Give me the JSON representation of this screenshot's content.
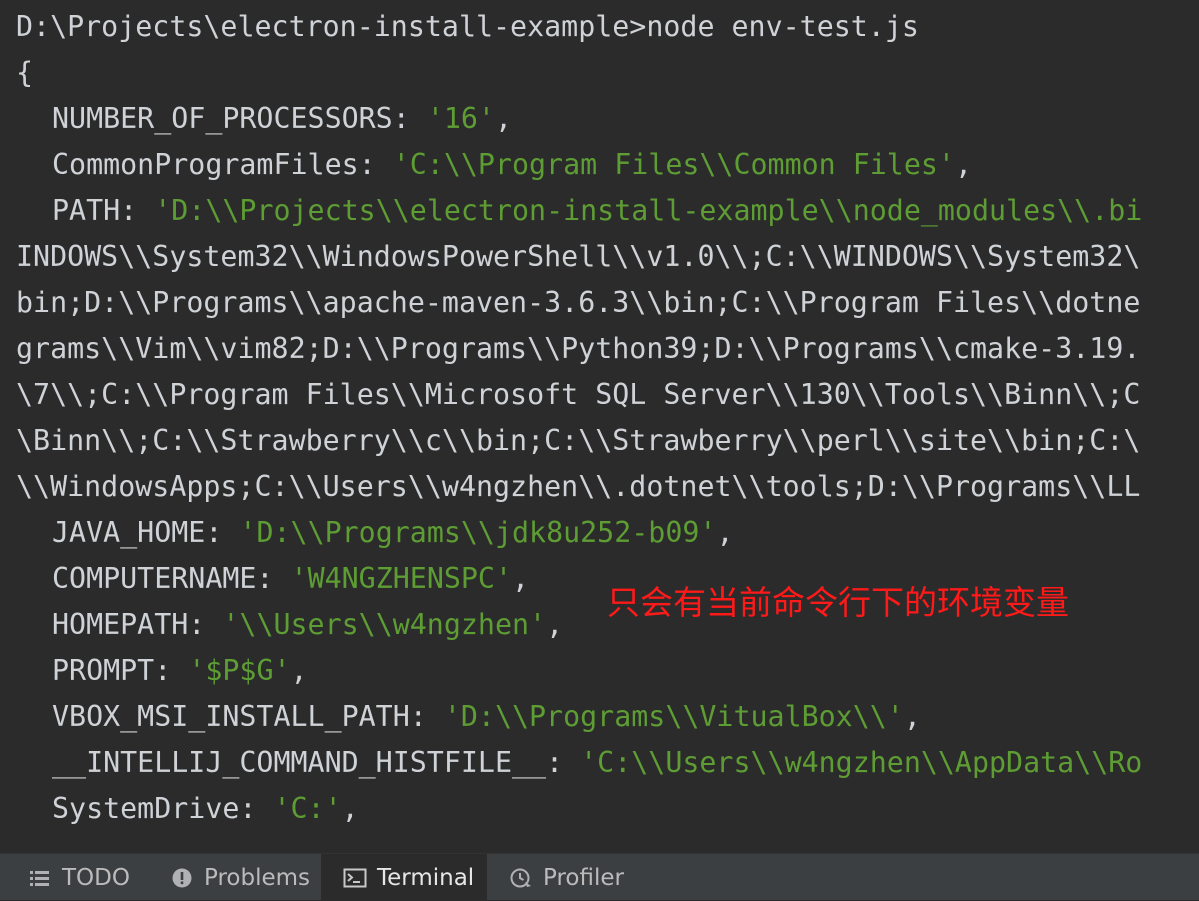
{
  "terminal": {
    "prompt_line": "D:\\Projects\\electron-install-example>node env-test.js",
    "open_brace": "{",
    "entries": {
      "number_of_processors": {
        "key": "NUMBER_OF_PROCESSORS:",
        "value": "'16'",
        "suffix": ","
      },
      "common_program_files": {
        "key": "CommonProgramFiles:",
        "value": "'C:\\\\Program Files\\\\Common Files'",
        "suffix": ","
      },
      "path": {
        "key": "PATH:",
        "value_first": "'D:\\\\Projects\\\\electron-install-example\\\\node_modules\\\\.bi",
        "wrapped_lines": [
          "INDOWS\\\\System32\\\\WindowsPowerShell\\\\v1.0\\\\;C:\\\\WINDOWS\\\\System32\\",
          "bin;D:\\\\Programs\\\\apache-maven-3.6.3\\\\bin;C:\\\\Program Files\\\\dotne",
          "grams\\\\Vim\\\\vim82;D:\\\\Programs\\\\Python39;D:\\\\Programs\\\\cmake-3.19.",
          "\\7\\\\;C:\\\\Program Files\\\\Microsoft SQL Server\\\\130\\\\Tools\\\\Binn\\\\;C",
          "\\Binn\\\\;C:\\\\Strawberry\\\\c\\\\bin;C:\\\\Strawberry\\\\perl\\\\site\\\\bin;C:\\",
          "\\\\WindowsApps;C:\\\\Users\\\\w4ngzhen\\\\.dotnet\\\\tools;D:\\\\Programs\\\\LL"
        ]
      },
      "java_home": {
        "key": "JAVA_HOME:",
        "value": "'D:\\\\Programs\\\\jdk8u252-b09'",
        "suffix": ","
      },
      "computername": {
        "key": "COMPUTERNAME:",
        "value": "'W4NGZHENSPC'",
        "suffix": ","
      },
      "homepath": {
        "key": "HOMEPATH:",
        "value": "'\\\\Users\\\\w4ngzhen'",
        "suffix": ","
      },
      "prompt": {
        "key": "PROMPT:",
        "value": "'$P$G'",
        "suffix": ","
      },
      "vbox_msi_install_path": {
        "key": "VBOX_MSI_INSTALL_PATH:",
        "value": "'D:\\\\Programs\\\\VitualBox\\\\'",
        "suffix": ","
      },
      "intellij_command_histfile": {
        "key": "__INTELLIJ_COMMAND_HISTFILE__:",
        "value": "'C:\\\\Users\\\\w4ngzhen\\\\AppData\\\\Ro",
        "suffix": ""
      },
      "system_drive": {
        "key": "SystemDrive:",
        "value": "'C:'",
        "suffix": ","
      }
    }
  },
  "annotation": {
    "text": "只会有当前命令行下的环境变量",
    "color": "#ff1a1a"
  },
  "toolbar": {
    "tabs": [
      {
        "label": "TODO",
        "icon": "list-icon",
        "active": false
      },
      {
        "label": "Problems",
        "icon": "warning-circle-icon",
        "active": false
      },
      {
        "label": "Terminal",
        "icon": "terminal-icon",
        "active": true
      },
      {
        "label": "Profiler",
        "icon": "profiler-icon",
        "active": false
      }
    ]
  },
  "colors": {
    "background": "#2b2b2b",
    "text": "#cfd2d6",
    "string": "#5e9d34",
    "toolbar_bg": "#3c3f41"
  }
}
